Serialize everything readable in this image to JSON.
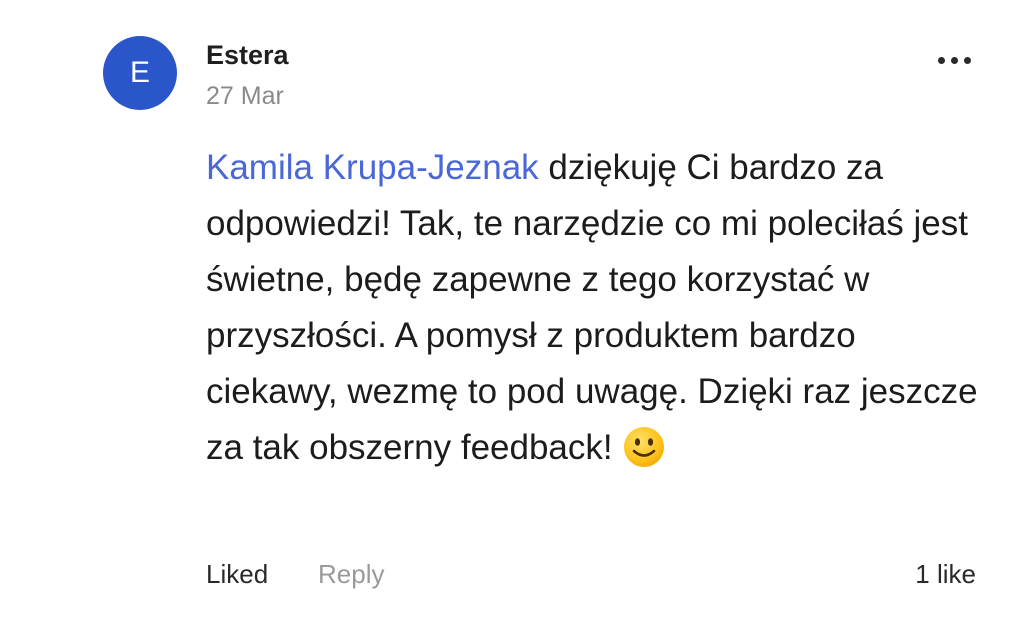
{
  "comment": {
    "avatar_letter": "E",
    "avatar_color": "#2b56c9",
    "author": "Estera",
    "date": "27 Mar",
    "mention": "Kamila Krupa-Jeznak",
    "mention_color": "#4a67d8",
    "text": " dziękuję Ci bardzo za odpowiedzi! Tak, te narzędzie co mi poleciłaś jest świetne, będę zapewne z tego korzystać w przyszłości. A pomysł z produktem bardzo ciekawy, wezmę to pod uwagę. Dzięki raz jeszcze za tak obszerny feedback!",
    "emoji_icon": "slightly-smiling-face-icon",
    "more_icon": "more-options-icon",
    "actions": {
      "liked_label": "Liked",
      "reply_label": "Reply",
      "like_count": "1 like"
    }
  }
}
